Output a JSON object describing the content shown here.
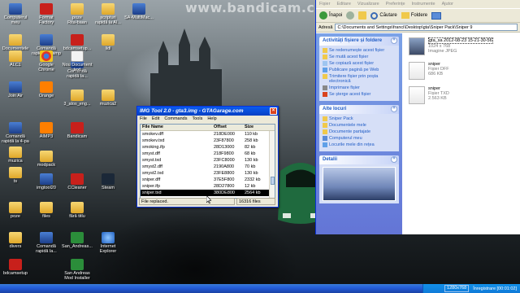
{
  "watermark": "www.bandicam.com",
  "desktop_icons": [
    {
      "label": "Computerul\nmeu",
      "icon": "computer-icon"
    },
    {
      "label": "Format\nFactory",
      "icon": "format-factory-icon"
    },
    {
      "label": "poze\nRita-baan",
      "icon": "folder-icon"
    },
    {
      "label": "scripturi\nrapidă la Al...",
      "icon": "folder-icon"
    },
    {
      "label": "SA-MultiMac...",
      "icon": "app-icon"
    },
    {
      "label": "Documentele\nmele",
      "icon": "documents-icon"
    },
    {
      "label": "Comandă\nrapidă la samp",
      "icon": "samp-icon"
    },
    {
      "label": "bdcamsetup...",
      "icon": "bandicam-setup-icon"
    },
    {
      "label": "lidl",
      "icon": "folder-icon"
    },
    {
      "label": "ALC1",
      "icon": "folder-icon"
    },
    {
      "label": "Google\nChrome",
      "icon": "chrome-icon"
    },
    {
      "label": "Comandă\nrapidă la...",
      "icon": "app-icon"
    },
    {
      "label": "Nou Document\ntext",
      "icon": "text-document-icon"
    },
    {
      "label": "Join Air",
      "icon": "app-icon"
    },
    {
      "label": "Orange",
      "icon": "orange-icon"
    },
    {
      "label": "3_alos_eng...",
      "icon": "folder-icon"
    },
    {
      "label": "muzica2",
      "icon": "folder-icon"
    },
    {
      "label": "Comandă\nrapidă la 4-pa",
      "icon": "app-icon"
    },
    {
      "label": "AIMP3",
      "icon": "aimp-icon"
    },
    {
      "label": "Bandicam",
      "icon": "bandicam-icon"
    },
    {
      "label": "muzica",
      "icon": "folder-icon"
    },
    {
      "label": "modpack",
      "icon": "folder-icon"
    },
    {
      "label": "ts",
      "icon": "folder-icon"
    },
    {
      "label": "imgtool20",
      "icon": "imgtool-icon"
    },
    {
      "label": "CCleaner",
      "icon": "ccleaner-icon"
    },
    {
      "label": "Steam",
      "icon": "steam-icon"
    },
    {
      "label": "poze",
      "icon": "folder-icon"
    },
    {
      "label": "files",
      "icon": "folder-icon"
    },
    {
      "label": "fără titlu",
      "icon": "folder-icon"
    },
    {
      "label": "divers",
      "icon": "folder-icon"
    },
    {
      "label": "Comandă\nrapidă la...",
      "icon": "app-icon"
    },
    {
      "label": "San_Andreas...",
      "icon": "gta-icon"
    },
    {
      "label": "Internet\nExplorer",
      "icon": "ie-icon"
    },
    {
      "label": "bdcamsetup",
      "icon": "bandicam-setup-icon"
    },
    {
      "label": "San Andreas\nMod Installer",
      "icon": "mod-installer-icon"
    }
  ],
  "imgtool": {
    "title": "IMG Tool 2.0 - gta3.img - GTAGarage.com",
    "menu": [
      "File",
      "Edit",
      "Commands",
      "Tools",
      "Help"
    ],
    "columns": [
      "File Name",
      "Offset",
      "Size"
    ],
    "rows": [
      {
        "name": "smokev.dff",
        "offset": "218DE000",
        "size": "110 kb"
      },
      {
        "name": "smokev.txd",
        "offset": "23F87800",
        "size": "258 kb"
      },
      {
        "name": "smoking.ifp",
        "offset": "28D13000",
        "size": "82 kb"
      },
      {
        "name": "smyst.dff",
        "offset": "218F9800",
        "size": "68 kb"
      },
      {
        "name": "smyst.txd",
        "offset": "23FC8000",
        "size": "130 kb"
      },
      {
        "name": "smyst2.dff",
        "offset": "2190A800",
        "size": "70 kb"
      },
      {
        "name": "smyst2.txd",
        "offset": "23FE8800",
        "size": "130 kb"
      },
      {
        "name": "sniper.dff",
        "offset": "37E5F800",
        "size": "2332 kb"
      },
      {
        "name": "sniper.ifp",
        "offset": "28D27800",
        "size": "12 kb"
      },
      {
        "name": "sniper.txd",
        "offset": "380DE800",
        "size": "2564 kb"
      }
    ],
    "selected_index": 9,
    "status": "File replaced.",
    "file_count": "16316 files"
  },
  "explorer": {
    "menu": [
      "Fișier",
      "Editare",
      "Vizualizare",
      "Preferințe",
      "Instrumente",
      "Ajutor"
    ],
    "toolbar": {
      "back": "Înapoi",
      "search": "Căutare",
      "folders": "Foldere"
    },
    "address_label": "Adresă",
    "address": "C:\\Documents and Settings\\franci\\Desktop\\gta\\Sniper Pack\\Sniper 9",
    "tasks_panel": {
      "title": "Activități fișiere și foldere",
      "links": [
        "Se redenumește acest fișier",
        "Se mută acest fișier",
        "Se copiază acest fișier",
        "Publicare pagină pe Web",
        "Trimitere fișier prin poșta electronică",
        "Imprimare fișier",
        "Se șterge acest fișier"
      ]
    },
    "places_panel": {
      "title": "Alte locuri",
      "links": [
        "Sniper Pack",
        "Documentele mele",
        "Documente partajate",
        "Computerul meu",
        "Locurile mele din rețea"
      ]
    },
    "details_panel": {
      "title": "Detalii"
    },
    "files": [
      {
        "name": "gta_sa 2012-08-23 15-21-30-56",
        "line2": "1024 x 768",
        "line3": "Imagine JPEG",
        "kind": "jpg"
      },
      {
        "name": "sniper",
        "line2": "Fișier DFF",
        "line3": "686 KB",
        "kind": "dff"
      },
      {
        "name": "sniper",
        "line2": "Fișier TXD",
        "line3": "2.563 KB",
        "kind": "txd"
      }
    ]
  },
  "taskbar": {
    "resolution": "1280x768",
    "recording": "Înregistrare [00:01:02]"
  }
}
